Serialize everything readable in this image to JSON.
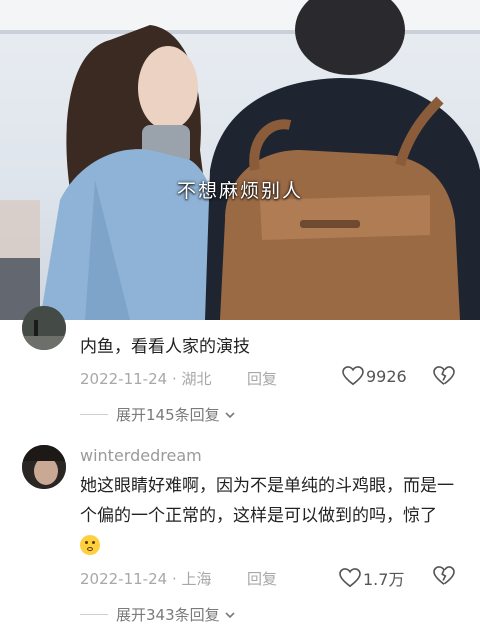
{
  "video": {
    "subtitle": "不想麻烦别人"
  },
  "comments": [
    {
      "username": "",
      "text": "内鱼，看看人家的演技",
      "date": "2022-11-24",
      "location": "湖北",
      "reply_label": "回复",
      "likes": "9926",
      "expand_label": "展开145条回复"
    },
    {
      "username": "winterdedream",
      "text": "她这眼睛好难啊，因为不是单纯的斗鸡眼，而是一个偏的一个正常的，这样是可以做到的吗，惊了",
      "date": "2022-11-24",
      "location": "上海",
      "reply_label": "回复",
      "likes": "1.7万",
      "expand_label": "展开343条回复"
    }
  ],
  "colors": {
    "text": "#222222",
    "meta": "#a8a8a8",
    "emoji": "#ffcf3f"
  }
}
